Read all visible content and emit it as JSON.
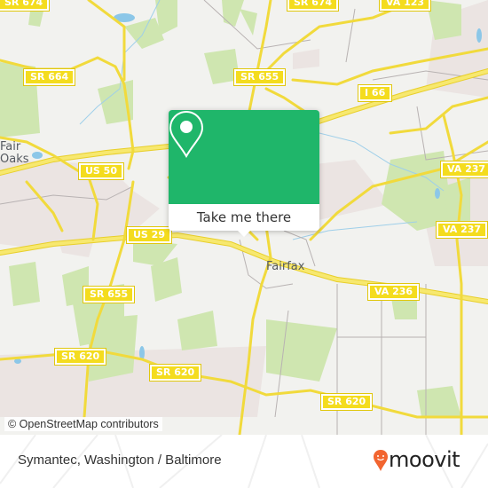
{
  "map": {
    "road_shields": [
      {
        "label": "SR 674",
        "id": "sr-674-topleft"
      },
      {
        "label": "SR 674",
        "id": "sr-674-top"
      },
      {
        "label": "VA 123",
        "id": "va-123"
      },
      {
        "label": "SR 664",
        "id": "sr-664"
      },
      {
        "label": "SR 655",
        "id": "sr-655-top"
      },
      {
        "label": "I 66",
        "id": "i-66"
      },
      {
        "label": "US 50",
        "id": "us-50"
      },
      {
        "label": "VA 237",
        "id": "va-237-upper"
      },
      {
        "label": "VA 237",
        "id": "va-237-lower"
      },
      {
        "label": "US 29",
        "id": "us-29"
      },
      {
        "label": "VA 236",
        "id": "va-236"
      },
      {
        "label": "SR 655",
        "id": "sr-655-bottom"
      },
      {
        "label": "SR 620",
        "id": "sr-620-left"
      },
      {
        "label": "SR 620",
        "id": "sr-620-center"
      },
      {
        "label": "SR 620",
        "id": "sr-620-right"
      }
    ],
    "places": [
      {
        "label": "Fair\nOaks",
        "line1": "Fair",
        "line2": "Oaks"
      },
      {
        "label": "Fairfax"
      }
    ],
    "attribution": "© OpenStreetMap contributors",
    "colors": {
      "background": "#f2f2ef",
      "park": "#cfe6b0",
      "road": "#f5e25a",
      "water": "#8cc7e8",
      "urban": "#ebe4e2"
    }
  },
  "popup": {
    "button_label": "Take me there",
    "icon": "map-pin-icon",
    "color": "#1fb66a"
  },
  "footer": {
    "title": "Symantec, Washington / Baltimore",
    "brand": "moovit",
    "brand_color": "#f26530"
  }
}
